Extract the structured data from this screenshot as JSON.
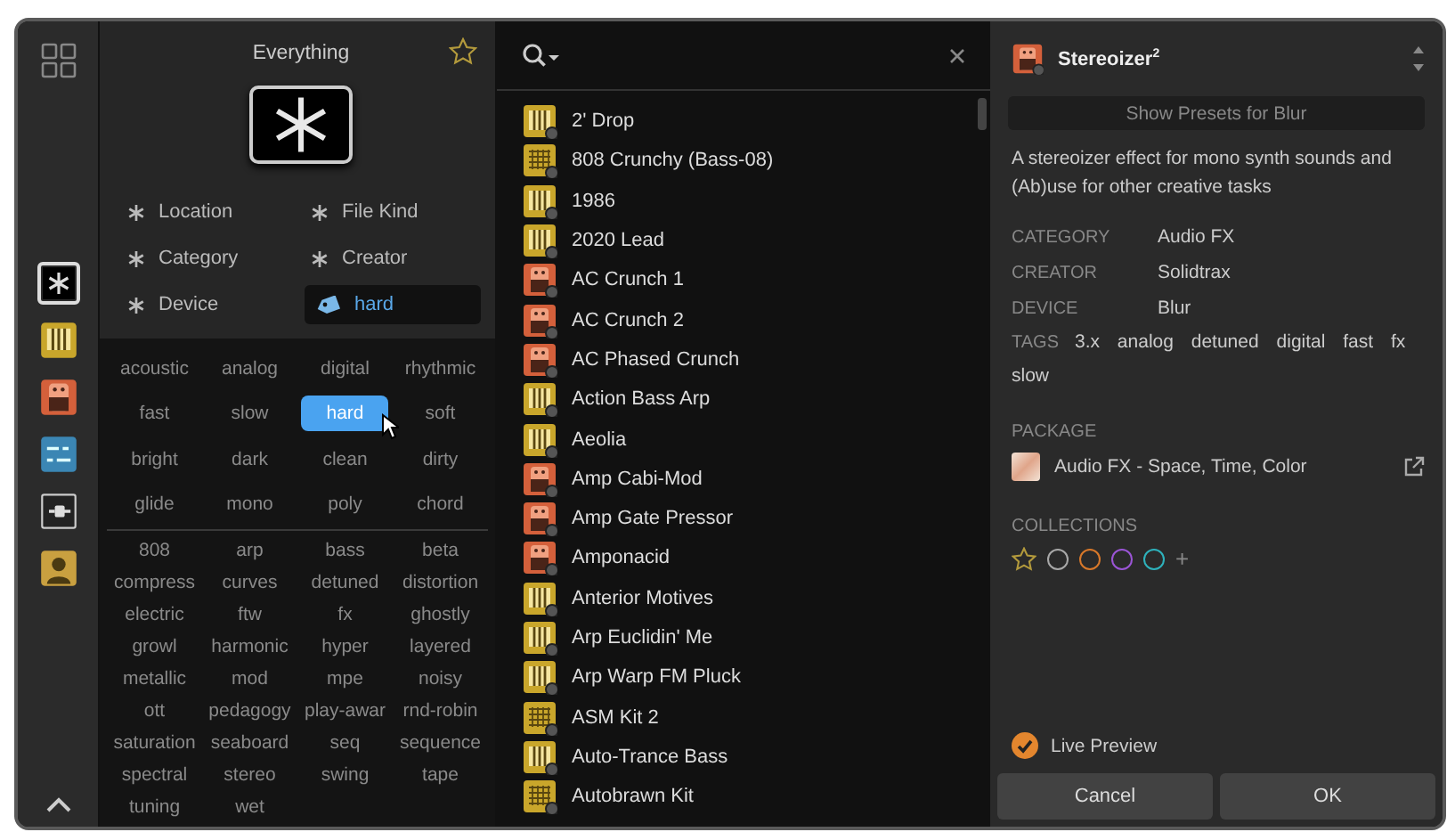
{
  "rail": {
    "items": [
      {
        "kind": "everything",
        "selected": true
      },
      {
        "kind": "instrument",
        "selected": false
      },
      {
        "kind": "effect",
        "selected": false
      },
      {
        "kind": "modulator",
        "selected": false
      },
      {
        "kind": "plugin",
        "selected": false
      },
      {
        "kind": "user",
        "selected": false
      }
    ]
  },
  "filter": {
    "title": "Everything",
    "facets": [
      {
        "label": "Location",
        "kind": "any",
        "selected": false
      },
      {
        "label": "File Kind",
        "kind": "any",
        "selected": false
      },
      {
        "label": "Category",
        "kind": "any",
        "selected": false
      },
      {
        "label": "Creator",
        "kind": "any",
        "selected": false
      },
      {
        "label": "Device",
        "kind": "any",
        "selected": false
      },
      {
        "label": "hard",
        "kind": "tag",
        "selected": true
      }
    ]
  },
  "tags": {
    "groups": [
      [
        {
          "label": "acoustic",
          "selected": false
        },
        {
          "label": "analog",
          "selected": false
        },
        {
          "label": "digital",
          "selected": false
        },
        {
          "label": "rhythmic",
          "selected": false
        },
        {
          "label": "fast",
          "selected": false
        },
        {
          "label": "slow",
          "selected": false
        },
        {
          "label": "hard",
          "selected": true
        },
        {
          "label": "soft",
          "selected": false
        },
        {
          "label": "bright",
          "selected": false
        },
        {
          "label": "dark",
          "selected": false
        },
        {
          "label": "clean",
          "selected": false
        },
        {
          "label": "dirty",
          "selected": false
        },
        {
          "label": "glide",
          "selected": false
        },
        {
          "label": "mono",
          "selected": false
        },
        {
          "label": "poly",
          "selected": false
        },
        {
          "label": "chord",
          "selected": false
        }
      ],
      [
        {
          "label": "808",
          "selected": false
        },
        {
          "label": "arp",
          "selected": false
        },
        {
          "label": "bass",
          "selected": false
        },
        {
          "label": "beta",
          "selected": false
        },
        {
          "label": "compress",
          "selected": false
        },
        {
          "label": "curves",
          "selected": false
        },
        {
          "label": "detuned",
          "selected": false
        },
        {
          "label": "distortion",
          "selected": false
        },
        {
          "label": "electric",
          "selected": false
        },
        {
          "label": "ftw",
          "selected": false
        },
        {
          "label": "fx",
          "selected": false
        },
        {
          "label": "ghostly",
          "selected": false
        },
        {
          "label": "growl",
          "selected": false
        },
        {
          "label": "harmonic",
          "selected": false
        },
        {
          "label": "hyper",
          "selected": false
        },
        {
          "label": "layered",
          "selected": false
        },
        {
          "label": "metallic",
          "selected": false
        },
        {
          "label": "mod",
          "selected": false
        },
        {
          "label": "mpe",
          "selected": false
        },
        {
          "label": "noisy",
          "selected": false
        },
        {
          "label": "ott",
          "selected": false
        },
        {
          "label": "pedagogy",
          "selected": false
        },
        {
          "label": "play-awar",
          "selected": false
        },
        {
          "label": "rnd-robin",
          "selected": false
        },
        {
          "label": "saturation",
          "selected": false
        },
        {
          "label": "seaboard",
          "selected": false
        },
        {
          "label": "seq",
          "selected": false
        },
        {
          "label": "sequence",
          "selected": false
        },
        {
          "label": "spectral",
          "selected": false
        },
        {
          "label": "stereo",
          "selected": false
        },
        {
          "label": "swing",
          "selected": false
        },
        {
          "label": "tape",
          "selected": false
        },
        {
          "label": "tuning",
          "selected": false
        },
        {
          "label": "wet",
          "selected": false
        }
      ]
    ]
  },
  "results": [
    {
      "name": "2' Drop",
      "kind": "instrument"
    },
    {
      "name": "808 Crunchy (Bass-08)",
      "kind": "drum"
    },
    {
      "name": "1986",
      "kind": "instrument"
    },
    {
      "name": "2020 Lead",
      "kind": "instrument"
    },
    {
      "name": "AC Crunch 1",
      "kind": "effect"
    },
    {
      "name": "AC Crunch 2",
      "kind": "effect"
    },
    {
      "name": "AC Phased Crunch",
      "kind": "effect"
    },
    {
      "name": "Action Bass Arp",
      "kind": "instrument"
    },
    {
      "name": "Aeolia",
      "kind": "instrument"
    },
    {
      "name": "Amp Cabi-Mod",
      "kind": "effect"
    },
    {
      "name": "Amp Gate Pressor",
      "kind": "effect"
    },
    {
      "name": "Amponacid",
      "kind": "effect"
    },
    {
      "name": "Anterior Motives",
      "kind": "instrument"
    },
    {
      "name": "Arp Euclidin' Me",
      "kind": "instrument"
    },
    {
      "name": "Arp Warp FM Pluck",
      "kind": "instrument"
    },
    {
      "name": "ASM Kit 2",
      "kind": "drum"
    },
    {
      "name": "Auto-Trance Bass",
      "kind": "instrument"
    },
    {
      "name": "Autobrawn Kit",
      "kind": "drum"
    }
  ],
  "details": {
    "title": "Stereoizer$^{2}$",
    "kind": "effect",
    "button": "Show Presets for Blur",
    "description": "A stereoizer effect for mono synth sounds and (Ab)use for other creative tasks",
    "properties": [
      {
        "label": "CATEGORY",
        "value": "Audio FX"
      },
      {
        "label": "CREATOR",
        "value": "Solidtrax"
      },
      {
        "label": "DEVICE",
        "value": "Blur"
      }
    ],
    "tags": {
      "label": "TAGS",
      "values": [
        "3.x",
        "analog",
        "detuned",
        "digital",
        "fast",
        "fx",
        "slow"
      ]
    },
    "package": {
      "label": "PACKAGE",
      "name": "Audio FX - Space, Time, Color"
    },
    "collections": {
      "label": "COLLECTIONS",
      "items": [
        {
          "color": "#a8a8a8"
        },
        {
          "color": "#d8782a"
        },
        {
          "color": "#9b55d6"
        },
        {
          "color": "#2eb2bc"
        }
      ],
      "add": "+"
    },
    "live_preview": {
      "label": "Live Preview",
      "checked": true
    },
    "buttons": [
      {
        "label": "Cancel"
      },
      {
        "label": "OK"
      }
    ]
  }
}
